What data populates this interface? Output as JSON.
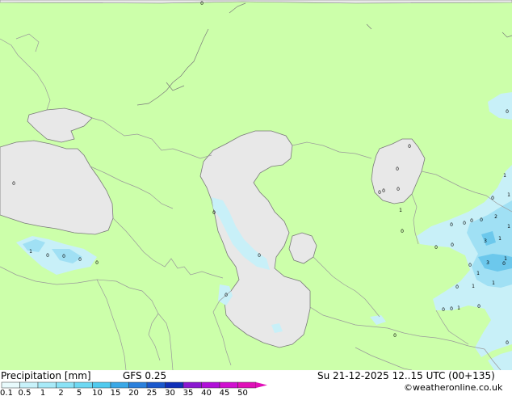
{
  "title": {
    "variable": "Precipitation [mm]",
    "model": "GFS 0.25",
    "datetime": "Su 21-12-2025 12..15 UTC (00+135)",
    "credit": "©weatheronline.co.uk"
  },
  "colors": {
    "land": "#ccffaa",
    "water": "#e8e8e8",
    "border": "#9a9a9a",
    "coast": "#7a7a7a",
    "precip_light": "#c8f0f8",
    "precip_mid": "#a0e0f4",
    "precip_heavy": "#6cc8ec"
  },
  "legend": {
    "labels": [
      "0.1",
      "0.5",
      "1",
      "2",
      "5",
      "10",
      "15",
      "20",
      "25",
      "30",
      "35",
      "40",
      "45",
      "50"
    ],
    "colors": [
      "#e8fafc",
      "#c8f2fa",
      "#a8eaf8",
      "#8ae2f6",
      "#6ed8f2",
      "#50caee",
      "#3aa8e6",
      "#2a80dc",
      "#1a58cc",
      "#1030b8",
      "#8a18d0",
      "#b010d8",
      "#d010d0",
      "#e010b8"
    ]
  },
  "precip_values": [
    {
      "t": "0"
    },
    {
      "t": "0"
    },
    {
      "t": "0"
    },
    {
      "t": "0"
    },
    {
      "t": "0"
    },
    {
      "t": "1"
    },
    {
      "t": "0"
    },
    {
      "t": "0"
    },
    {
      "t": "0"
    },
    {
      "t": "0"
    },
    {
      "t": "0"
    },
    {
      "t": "0"
    },
    {
      "t": "0"
    },
    {
      "t": "0"
    },
    {
      "t": "0"
    },
    {
      "t": "1"
    },
    {
      "t": "0"
    },
    {
      "t": "1"
    },
    {
      "t": "0"
    },
    {
      "t": "1"
    },
    {
      "t": "0"
    },
    {
      "t": "0"
    },
    {
      "t": "0"
    },
    {
      "t": "0"
    },
    {
      "t": "0"
    },
    {
      "t": "2"
    },
    {
      "t": "3"
    },
    {
      "t": "1"
    },
    {
      "t": "0"
    },
    {
      "t": "1"
    },
    {
      "t": "1"
    },
    {
      "t": "1"
    },
    {
      "t": "0"
    },
    {
      "t": "1"
    },
    {
      "t": "0"
    },
    {
      "t": "0"
    },
    {
      "t": "0"
    },
    {
      "t": "0"
    },
    {
      "t": "0"
    },
    {
      "t": "3"
    },
    {
      "t": "1"
    },
    {
      "t": "0"
    },
    {
      "t": "0"
    },
    {
      "t": "1"
    },
    {
      "t": "0"
    }
  ]
}
